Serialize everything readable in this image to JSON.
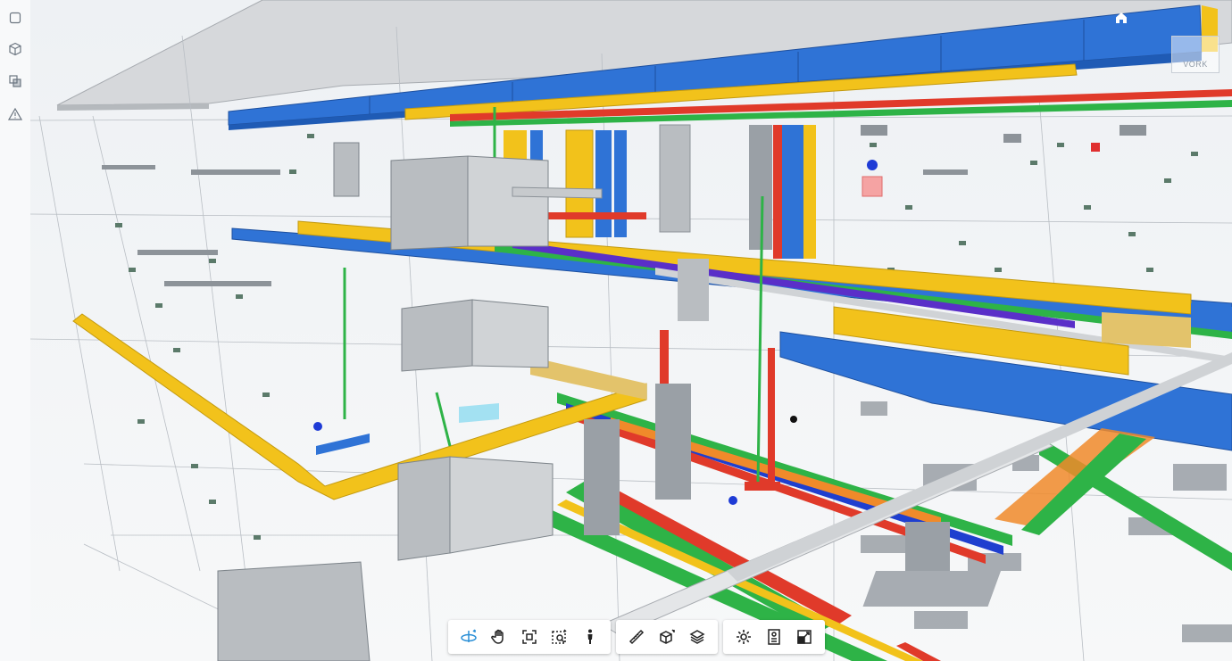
{
  "app": {
    "logo_text": "VORK"
  },
  "left_toolbar": {
    "items": [
      {
        "name": "model-cube",
        "icon": "cube-outline-icon"
      },
      {
        "name": "section-box",
        "icon": "section-cube-icon"
      },
      {
        "name": "views",
        "icon": "stacked-views-icon"
      },
      {
        "name": "issues",
        "icon": "warning-triangle-icon"
      }
    ]
  },
  "bottom_toolbar": {
    "groups": [
      {
        "name": "navigation",
        "items": [
          "orbit-icon",
          "pan-hand-icon",
          "fit-to-view-icon",
          "zoom-window-icon",
          "first-person-icon"
        ]
      },
      {
        "name": "tools",
        "items": [
          "measure-icon",
          "section-analysis-icon",
          "layers-icon"
        ]
      },
      {
        "name": "settings",
        "items": [
          "settings-gear-icon",
          "properties-icon",
          "full-screen-icon"
        ]
      }
    ],
    "active": "orbit-icon"
  },
  "colors": {
    "duct_blue": "#2f73d6",
    "cable_tray_yellow": "#f2c21b",
    "pipe_red": "#e03a2a",
    "pipe_green": "#2eb347",
    "pipe_blue": "#1f3fcf",
    "pipe_orange": "#f08a2a",
    "equipment_gray": "#b9bdc1",
    "accent": "#2a8fd6"
  }
}
